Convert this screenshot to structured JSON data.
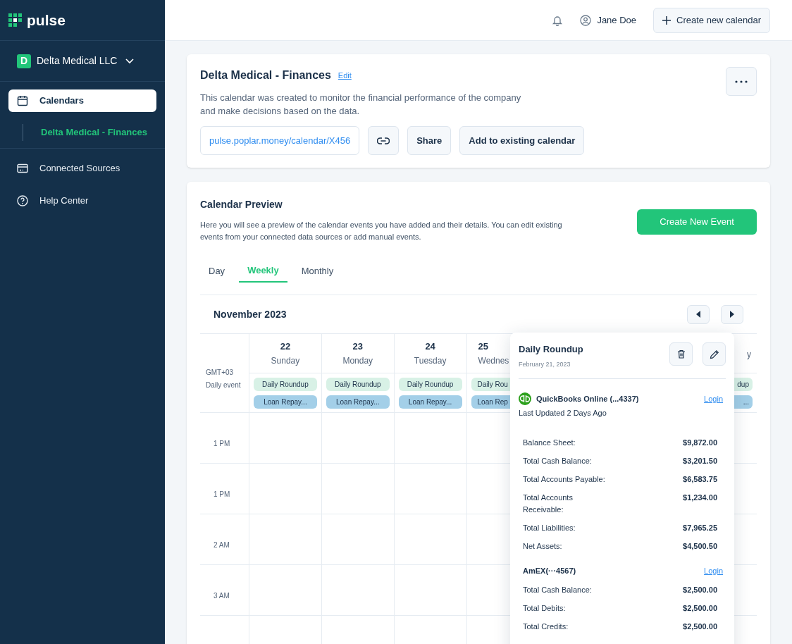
{
  "brand": {
    "name": "pulse"
  },
  "sidebar": {
    "org": {
      "initial": "D",
      "name": "Delta Medical LLC"
    },
    "items": [
      {
        "label": "Calendars",
        "selected": true,
        "children": [
          {
            "label": "Delta Medical - Finances",
            "selected": true
          }
        ]
      },
      {
        "label": "Connected Sources",
        "selected": false
      },
      {
        "label": "Help Center",
        "selected": false
      }
    ]
  },
  "header": {
    "user": "Jane Doe",
    "create_button": "Create new calendar"
  },
  "calendar_card": {
    "title": "Delta Medical - Finances",
    "edit_link": "Edit",
    "description": "This calendar was created to monitor the financial performance of the company and make decisions based on the data.",
    "url": "pulse.poplar.money/calendar/X456",
    "share_button": "Share",
    "add_button": "Add to existing calendar"
  },
  "preview": {
    "title": "Calendar Preview",
    "description": "Here you will see a preview of the calendar events you have added and their details. You can edit existing events from your connected data sources or add manual events.",
    "create_button": "Create New Event",
    "tabs": [
      {
        "label": "Day",
        "selected": false
      },
      {
        "label": "Weekly",
        "selected": true
      },
      {
        "label": "Monthly",
        "selected": false
      }
    ],
    "month": "November 2023",
    "timezone": "GMT+03",
    "daily_label": "Daily event",
    "days": [
      {
        "kind": "day",
        "date": "22",
        "name": "Sunday",
        "events": [
          {
            "kind": "roundup",
            "label": "Daily Roundup"
          },
          {
            "kind": "loan",
            "label": "Loan Repay..."
          }
        ]
      },
      {
        "kind": "day",
        "date": "23",
        "name": "Monday",
        "events": [
          {
            "kind": "roundup",
            "label": "Daily Roundup"
          },
          {
            "kind": "loan",
            "label": "Loan Repay..."
          }
        ]
      },
      {
        "kind": "day",
        "date": "24",
        "name": "Tuesday",
        "events": [
          {
            "kind": "roundup",
            "label": "Daily Roundup"
          },
          {
            "kind": "loan",
            "label": "Loan Repay..."
          }
        ]
      },
      {
        "kind": "day",
        "date": "25",
        "name": "Wednes",
        "events": [
          {
            "kind": "roundup",
            "label": "Daily Rou"
          },
          {
            "kind": "loan",
            "label": "Loan Rep"
          }
        ]
      },
      {
        "kind": "covered"
      },
      {
        "kind": "covered"
      },
      {
        "kind": "day",
        "name": "y",
        "events": [
          {
            "kind": "roundup",
            "label": "dup"
          },
          {
            "kind": "loan",
            "label": "..."
          }
        ]
      }
    ],
    "times": [
      "1 PM",
      "1 PM",
      "2 AM",
      "3 AM"
    ]
  },
  "popover": {
    "title": "Daily Roundup",
    "date": "February 21, 2023",
    "sources": [
      {
        "kind": "quickbooks",
        "name": "QuickBooks Online (...4337)",
        "login": "Login",
        "updated": "Last Updated 2 Days Ago",
        "metrics": [
          {
            "label": "Balance Sheet:",
            "value": "$9,872.00"
          },
          {
            "label": "Total Cash Balance:",
            "value": "$3,201.50"
          },
          {
            "label": "Total Accounts Payable:",
            "value": "$6,583.75"
          },
          {
            "label": "Total Accounts Receivable:",
            "value": "$1,234.00"
          },
          {
            "label": "Total Liabilities:",
            "value": "$7,965.25"
          },
          {
            "label": "Net Assets:",
            "value": "$4,500.50"
          }
        ]
      },
      {
        "kind": "card",
        "name": "AmEX(···4567)",
        "login": "Login",
        "metrics": [
          {
            "label": "Total Cash Balance:",
            "value": "$2,500.00"
          },
          {
            "label": "Total Debits:",
            "value": "$2,500.00"
          },
          {
            "label": "Total Credits:",
            "value": "$2,500.00"
          }
        ]
      }
    ]
  }
}
